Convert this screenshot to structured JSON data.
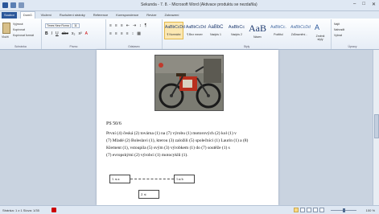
{
  "window": {
    "title": "Sekunda - 7. 8. - Microsoft Word (Aktivace produktu se nezdařila)",
    "controls": [
      "–",
      "□",
      "✕"
    ]
  },
  "quick_access": [
    "word-icon",
    "save-icon",
    "undo-icon"
  ],
  "tabs": [
    "Soubor",
    "Domů",
    "Vložení",
    "Rozložení stránky",
    "Reference",
    "Korespondence",
    "Revize",
    "Zobrazení"
  ],
  "ribbon": {
    "clipboard": {
      "items": [
        "Vyjmout",
        "Kopírovat",
        "Kopírovat formát"
      ],
      "paste": "Vložit",
      "label": "Schránka"
    },
    "font": {
      "name": "Times New Roma",
      "size": "11",
      "format_buttons": [
        "B",
        "I",
        "U",
        "abe",
        "x₂",
        "x²",
        "A"
      ],
      "label": "Písmo"
    },
    "paragraph": {
      "row1": [
        "≡",
        "≡",
        "≡",
        "⇤",
        "⇥",
        "↕",
        "¶"
      ],
      "row2": [
        "≡",
        "≡",
        "≡",
        "≡",
        "↕",
        "▦"
      ],
      "label": "Odstavec"
    },
    "styles": {
      "items": [
        {
          "sample": "AaBbCcDd",
          "name": "¶ Normální"
        },
        {
          "sample": "AaBbCcDd",
          "name": "¶ Bez mezer"
        },
        {
          "sample": "AaBbC",
          "name": "Nadpis 1"
        },
        {
          "sample": "AaBbCc",
          "name": "Nadpis 2"
        },
        {
          "sample": "AaB",
          "name": "Název"
        },
        {
          "sample": "AaBbCc.",
          "name": "Podtitul"
        },
        {
          "sample": "AaBbCcDd",
          "name": "Zdůraznění..."
        }
      ],
      "label": "Styly",
      "change": "Změnit styly"
    },
    "editing": {
      "items": [
        "Najít",
        "Nahradit",
        "Vybrat"
      ],
      "label": "Úpravy"
    }
  },
  "document": {
    "heading": "PS 50/6",
    "lines": [
      "První (4) česká (2) továrna (1) na (7) výrobu (1) motorových (2) kol (1) v",
      "(7) Mladé (2) Boleslavi (1), kterou (3) založili (5) společníci (1) Laurin (1) a (8)",
      "Klement (1), vstoupila (5) svým (3) výrobkem (1) do (7) soutěže (1) s",
      "(7) evropskými (2) výrobci (1) motocyklů (1)."
    ],
    "table": {
      "cell1": "1. st a",
      "cell2": "1.st b",
      "cell3": "2. st"
    }
  },
  "status": {
    "text": "Stránka: 1 z 1   Slova: 1/35",
    "zoom": "100 %"
  }
}
